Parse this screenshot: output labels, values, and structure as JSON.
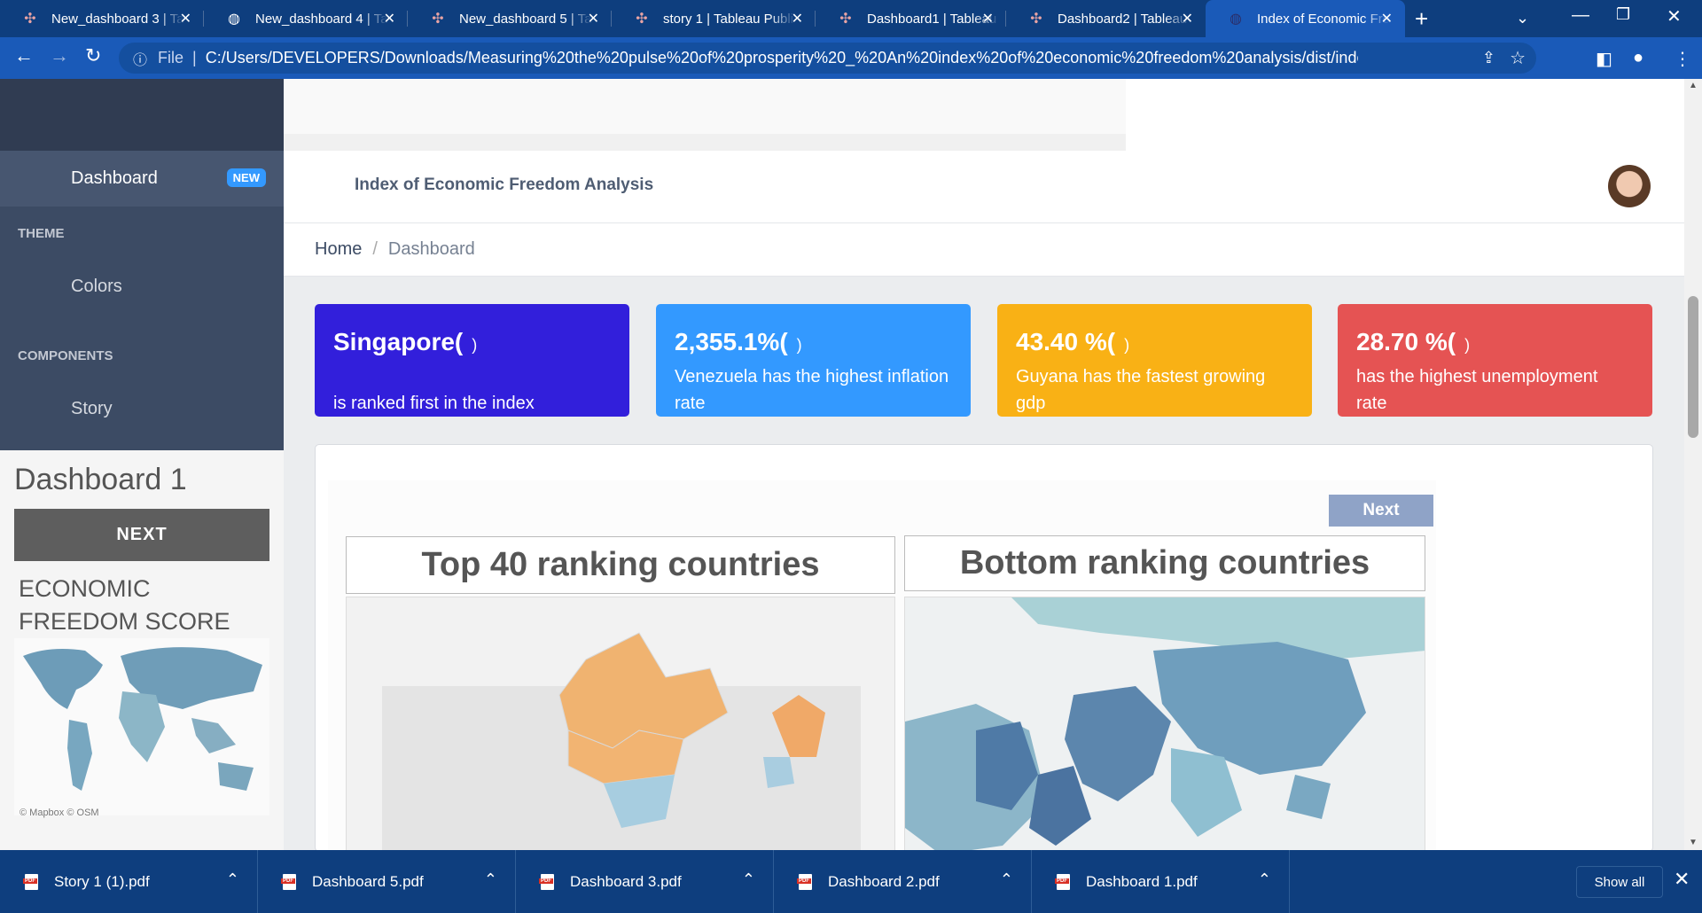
{
  "browser": {
    "tabs": [
      {
        "title": "New_dashboard 3 | Ta",
        "icon": "tableau-icon"
      },
      {
        "title": "New_dashboard 4 | Ta",
        "icon": "globe-icon"
      },
      {
        "title": "New_dashboard 5 | Ta",
        "icon": "tableau-icon"
      },
      {
        "title": "story 1 | Tableau Publi",
        "icon": "tableau-icon"
      },
      {
        "title": "Dashboard1 | Tableau",
        "icon": "tableau-icon"
      },
      {
        "title": "Dashboard2 | Tableau",
        "icon": "tableau-icon"
      },
      {
        "title": "Index of Economic Fre",
        "icon": "page-icon"
      }
    ],
    "address": {
      "scheme_label": "File",
      "url": "C:/Users/DEVELOPERS/Downloads/Measuring%20the%20pulse%20of%20prosperity%20_%20An%20index%20of%20economic%20freedom%20analysis/dist/index.html"
    }
  },
  "sidebar": {
    "dashboard_label": "Dashboard",
    "dashboard_badge": "NEW",
    "theme_title": "THEME",
    "colors_label": "Colors",
    "components_title": "COMPONENTS",
    "story_label": "Story",
    "embed": {
      "title": "Dashboard 1",
      "next_label": "NEXT",
      "score_title": "ECONOMIC FREEDOM SCORE",
      "credit": "© Mapbox © OSM"
    }
  },
  "header": {
    "app_title": "Index of Economic Freedom Analysis"
  },
  "breadcrumb": {
    "home": "Home",
    "separator": "/",
    "current": "Dashboard"
  },
  "cards": [
    {
      "big": "Singapore(",
      "paren": ")",
      "sub": "is ranked first in the index",
      "color": "#321fdb"
    },
    {
      "big": "2,355.1%(",
      "paren": ")",
      "sub": "Venezuela has the highest inflation rate",
      "color": "#3399ff"
    },
    {
      "big": "43.40 %(",
      "paren": ")",
      "sub": "Guyana has the fastest growing gdp",
      "color": "#f9b115"
    },
    {
      "big": "28.70 %(",
      "paren": ")",
      "sub": "has the highest unemployment rate",
      "color": "#e55353"
    }
  ],
  "viz": {
    "next_label": "Next",
    "top_title": "Top 40 ranking countries",
    "bottom_title": "Bottom ranking countries"
  },
  "downloads": {
    "items": [
      "Story 1 (1).pdf",
      "Dashboard 5.pdf",
      "Dashboard 3.pdf",
      "Dashboard 2.pdf",
      "Dashboard 1.pdf"
    ],
    "show_all": "Show all"
  }
}
